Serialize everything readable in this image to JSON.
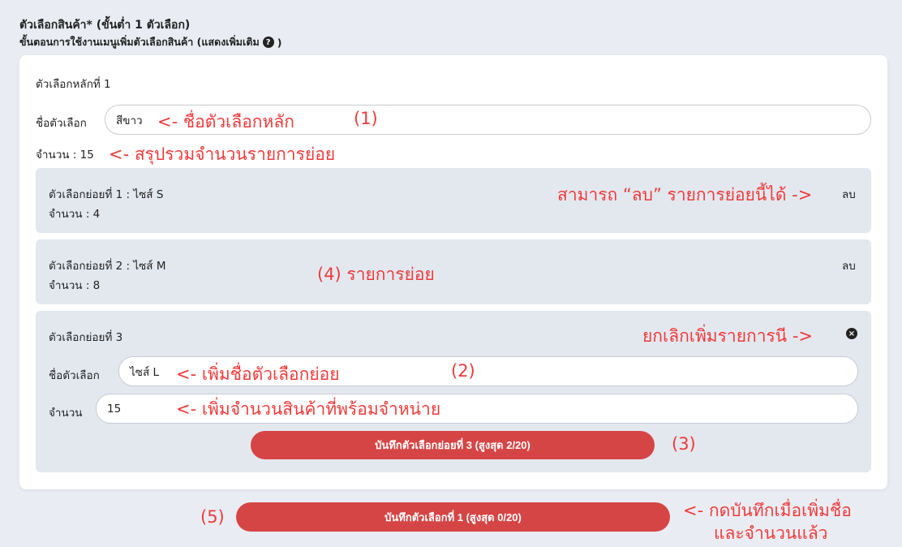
{
  "header": {
    "title": "ตัวเลือกสินค้า* (ขั้นต่ำ 1 ตัวเลือก)",
    "subtitle": "ขั้นตอนการใช้งานเมนูเพิ่มตัวเลือกสินค้า (แสดงเพิ่มเติม",
    "subtitle_end": ")",
    "help_icon": "?"
  },
  "main_option": {
    "heading": "ตัวเลือกหลักที่ 1",
    "name_label": "ชื่อตัวเลือก",
    "name_value": "สีขาว",
    "quantity_text": "จำนวน : 15"
  },
  "sub_options": [
    {
      "title": "ตัวเลือกย่อยที่ 1 : ไซส์ S",
      "quantity": "จำนวน : 4",
      "delete_label": "ลบ"
    },
    {
      "title": "ตัวเลือกย่อยที่ 2 : ไซส์ M",
      "quantity": "จำนวน : 8",
      "delete_label": "ลบ"
    }
  ],
  "sub_edit": {
    "title": "ตัวเลือกย่อยที่ 3",
    "close_icon": "×",
    "name_label": "ชื่อตัวเลือก",
    "name_value": "ไซส์ L",
    "qty_label": "จำนวน",
    "qty_value": "15",
    "save_label": "บันทึกตัวเลือกย่อยที่ 3 (สูงสุด 2/20)"
  },
  "save_main_label": "บันทึกตัวเลือกที่ 1 (สูงสุด 0/20)",
  "annotations": {
    "main_name": "<- ชื่อตัวเลือกหลัก",
    "num1": "(1)",
    "summary": "<- สรุปรวมจำนวนรายการย่อย",
    "delete_hint": "สามารถ “ลบ” รายการย่อยนี้ได้ ->",
    "sub_items": "(4) รายการย่อย",
    "cancel_hint": "ยกเลิกเพิ่มรายการนี ->",
    "sub_name": "<- เพิ่มชื่อตัวเลือกย่อย",
    "num2": "(2)",
    "sub_qty": "<- เพิ่มจำนวนสินค้าที่พร้อมจำหน่าย",
    "num3": "(3)",
    "num5": "(5)",
    "save_hint_line1": "<- กดบันทึกเมื่อเพิ่มชื่อ",
    "save_hint_line2": "และจำนวนแล้ว"
  },
  "colors": {
    "annotation": "#f03a3a",
    "button": "#d64545",
    "sub_bg": "#e3e8ef",
    "page_bg": "#e9edf3"
  }
}
